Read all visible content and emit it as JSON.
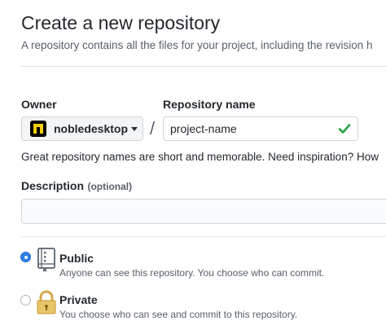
{
  "header": {
    "title": "Create a new repository",
    "subtitle": "A repository contains all the files for your project, including the revision h"
  },
  "owner": {
    "label": "Owner",
    "value": "nobledesktop"
  },
  "separator": "/",
  "repository_name": {
    "label": "Repository name",
    "value": "project-name",
    "valid": true
  },
  "hint": "Great repository names are short and memorable. Need inspiration? How",
  "description": {
    "label": "Description",
    "optional": "(optional)",
    "value": ""
  },
  "visibility": {
    "selected": "public",
    "public": {
      "title": "Public",
      "description": "Anyone can see this repository. You choose who can commit."
    },
    "private": {
      "title": "Private",
      "description": "You choose who can see and commit to this repository."
    }
  },
  "colors": {
    "accent": "#2f7ee2",
    "success": "#28a745",
    "text": "#24292e",
    "muted": "#586069"
  },
  "icons": {
    "owner_avatar": "nobledesktop-logo-icon",
    "valid": "check-icon",
    "public": "repo-icon",
    "private": "lock-icon"
  }
}
